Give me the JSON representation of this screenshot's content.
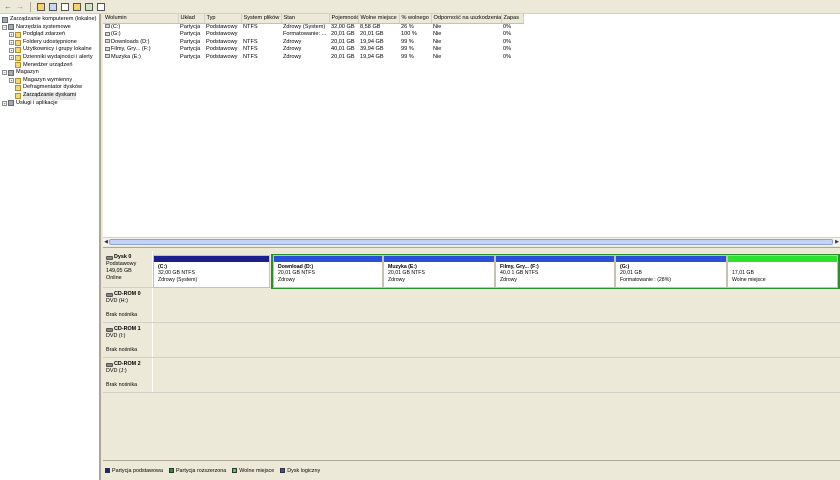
{
  "tree": {
    "root": "Zarządzanie komputerem (lokalne)",
    "items": [
      {
        "label": "Narzędzia systemowe",
        "level": 1,
        "expander": "−"
      },
      {
        "label": "Podgląd zdarzeń",
        "level": 2,
        "expander": "+"
      },
      {
        "label": "Foldery udostępnione",
        "level": 2,
        "expander": "+"
      },
      {
        "label": "Użytkownicy i grupy lokalne",
        "level": 2,
        "expander": "+"
      },
      {
        "label": "Dzienniki wydajności i alerty",
        "level": 2,
        "expander": "+"
      },
      {
        "label": "Menedżer urządzeń",
        "level": 2,
        "expander": ""
      },
      {
        "label": "Magazyn",
        "level": 1,
        "expander": "−"
      },
      {
        "label": "Magazyn wymienny",
        "level": 2,
        "expander": "+"
      },
      {
        "label": "Defragmentator dysków",
        "level": 2,
        "expander": ""
      },
      {
        "label": "Zarządzanie dyskami",
        "level": 2,
        "expander": ""
      },
      {
        "label": "Usługi i aplikacje",
        "level": 1,
        "expander": "+"
      }
    ]
  },
  "volumes": {
    "headers": [
      "Wolumin",
      "Układ",
      "Typ",
      "System plików",
      "Stan",
      "Pojemność",
      "Wolne miejsce",
      "% wolnego",
      "Odporność na uszkodzenia",
      "Zapas"
    ],
    "rows": [
      [
        "(C:)",
        "Partycja",
        "Podstawowy",
        "NTFS",
        "Zdrowy (System)",
        "32,00 GB",
        "8,58 GB",
        "26 %",
        "Nie",
        "0%"
      ],
      [
        "(G:)",
        "Partycja",
        "Podstawowy",
        "",
        "Formatowanie: ...",
        "20,01 GB",
        "20,01 GB",
        "100 %",
        "Nie",
        "0%"
      ],
      [
        "Downloads (D:)",
        "Partycja",
        "Podstawowy",
        "NTFS",
        "Zdrowy",
        "20,01 GB",
        "19,94 GB",
        "99 %",
        "Nie",
        "0%"
      ],
      [
        "Filmy, Gry... (F:)",
        "Partycja",
        "Podstawowy",
        "NTFS",
        "Zdrowy",
        "40,01 GB",
        "39,94 GB",
        "99 %",
        "Nie",
        "0%"
      ],
      [
        "Muzyka (E:)",
        "Partycja",
        "Podstawowy",
        "NTFS",
        "Zdrowy",
        "20,01 GB",
        "19,94 GB",
        "99 %",
        "Nie",
        "0%"
      ]
    ]
  },
  "disks": [
    {
      "name": "Dysk 0",
      "type": "Podstawowy",
      "size": "149,05 GB",
      "status": "Online",
      "partitions": [
        {
          "title": "(C:)",
          "line1": "32,00 GB NTFS",
          "line2": "Zdrowy (System)"
        },
        {
          "title": "Download (D:)",
          "line1": "20,01 GB NTFS",
          "line2": "Zdrowy"
        },
        {
          "title": "Muzyka (E:)",
          "line1": "20,01 GB NTFS",
          "line2": "Zdrowy"
        },
        {
          "title": "Filmy, Gry... (F:)",
          "line1": "40,0 1 GB NTFS",
          "line2": "Zdrowy"
        },
        {
          "title": "(G:)",
          "line1": "20,01 GB",
          "line2": "Formatowanie : (28%)"
        },
        {
          "title": "",
          "line1": "17,01 GB",
          "line2": "Wolne miejsce"
        }
      ]
    },
    {
      "name": "CD-ROM 0",
      "type": "DVD (H:)",
      "status": "Brak nośnika"
    },
    {
      "name": "CD-ROM 1",
      "type": "DVD (I:)",
      "status": "Brak nośnika"
    },
    {
      "name": "CD-ROM 2",
      "type": "DVD (J:)",
      "status": "Brak nośnika"
    }
  ],
  "legend": [
    {
      "label": "Partycja podstawowa",
      "color": "#1b1f8c"
    },
    {
      "label": "Partycja rozszerzona",
      "color": "#2b8f2b"
    },
    {
      "label": "Wolne miejsce",
      "color": "#2ee030"
    },
    {
      "label": "Dysk logiczny",
      "color": "#2a4fd8"
    }
  ],
  "colors": {
    "primary_partition": "#1b1f8c",
    "extended_partition": "#2b8f2b",
    "free_space": "#2ee030",
    "logical_drive": "#2a4fd8"
  }
}
